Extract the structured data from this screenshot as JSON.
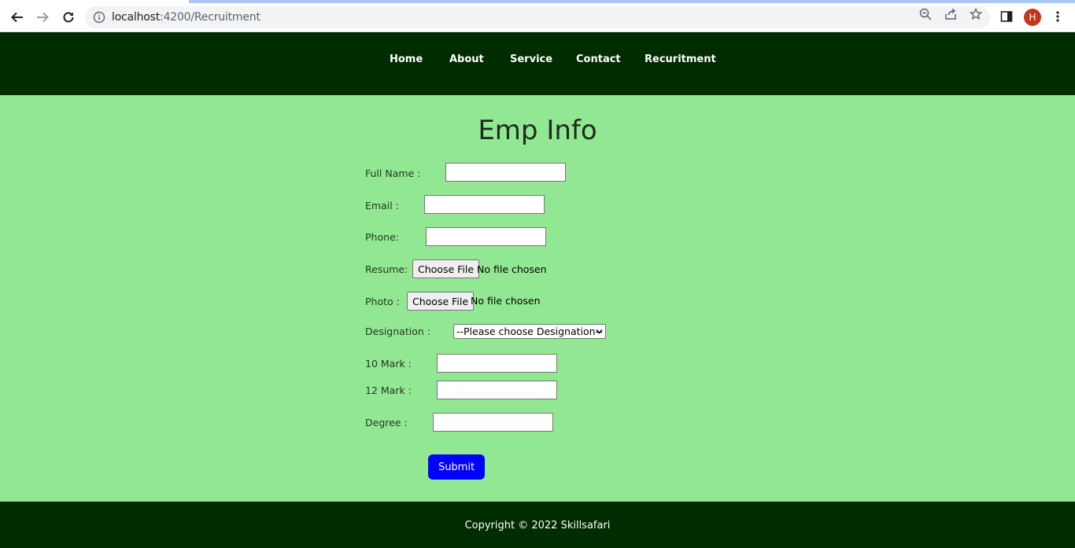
{
  "browser": {
    "url_host": "localhost",
    "url_rest": ":4200/Recruitment",
    "avatar_letter": "H"
  },
  "nav": {
    "items": [
      {
        "label": "Home"
      },
      {
        "label": "About"
      },
      {
        "label": "Service"
      },
      {
        "label": "Contact"
      },
      {
        "label": "Recuritment"
      }
    ]
  },
  "form": {
    "title": "Emp Info",
    "full_name_label": "Full Name :",
    "full_name_value": "",
    "email_label": "Email :",
    "email_value": "",
    "phone_label": "Phone:",
    "phone_value": "",
    "resume_label": "Resume:",
    "resume_button": "Choose File",
    "resume_status": "No file chosen",
    "photo_label": "Photo :",
    "photo_button": "Choose File",
    "photo_status": "No file chosen",
    "designation_label": "Designation :",
    "designation_selected": "--Please choose Designation--",
    "mark10_label": "10 Mark :",
    "mark10_value": "",
    "mark12_label": "12 Mark :",
    "mark12_value": "",
    "degree_label": "Degree :",
    "degree_value": "",
    "submit_label": "Submit"
  },
  "footer": {
    "copyright": "Copyright © 2022 Skillsafari"
  },
  "colors": {
    "page_bg": "#92e892",
    "header_bg": "#002d00",
    "submit_bg": "#0000ff"
  }
}
